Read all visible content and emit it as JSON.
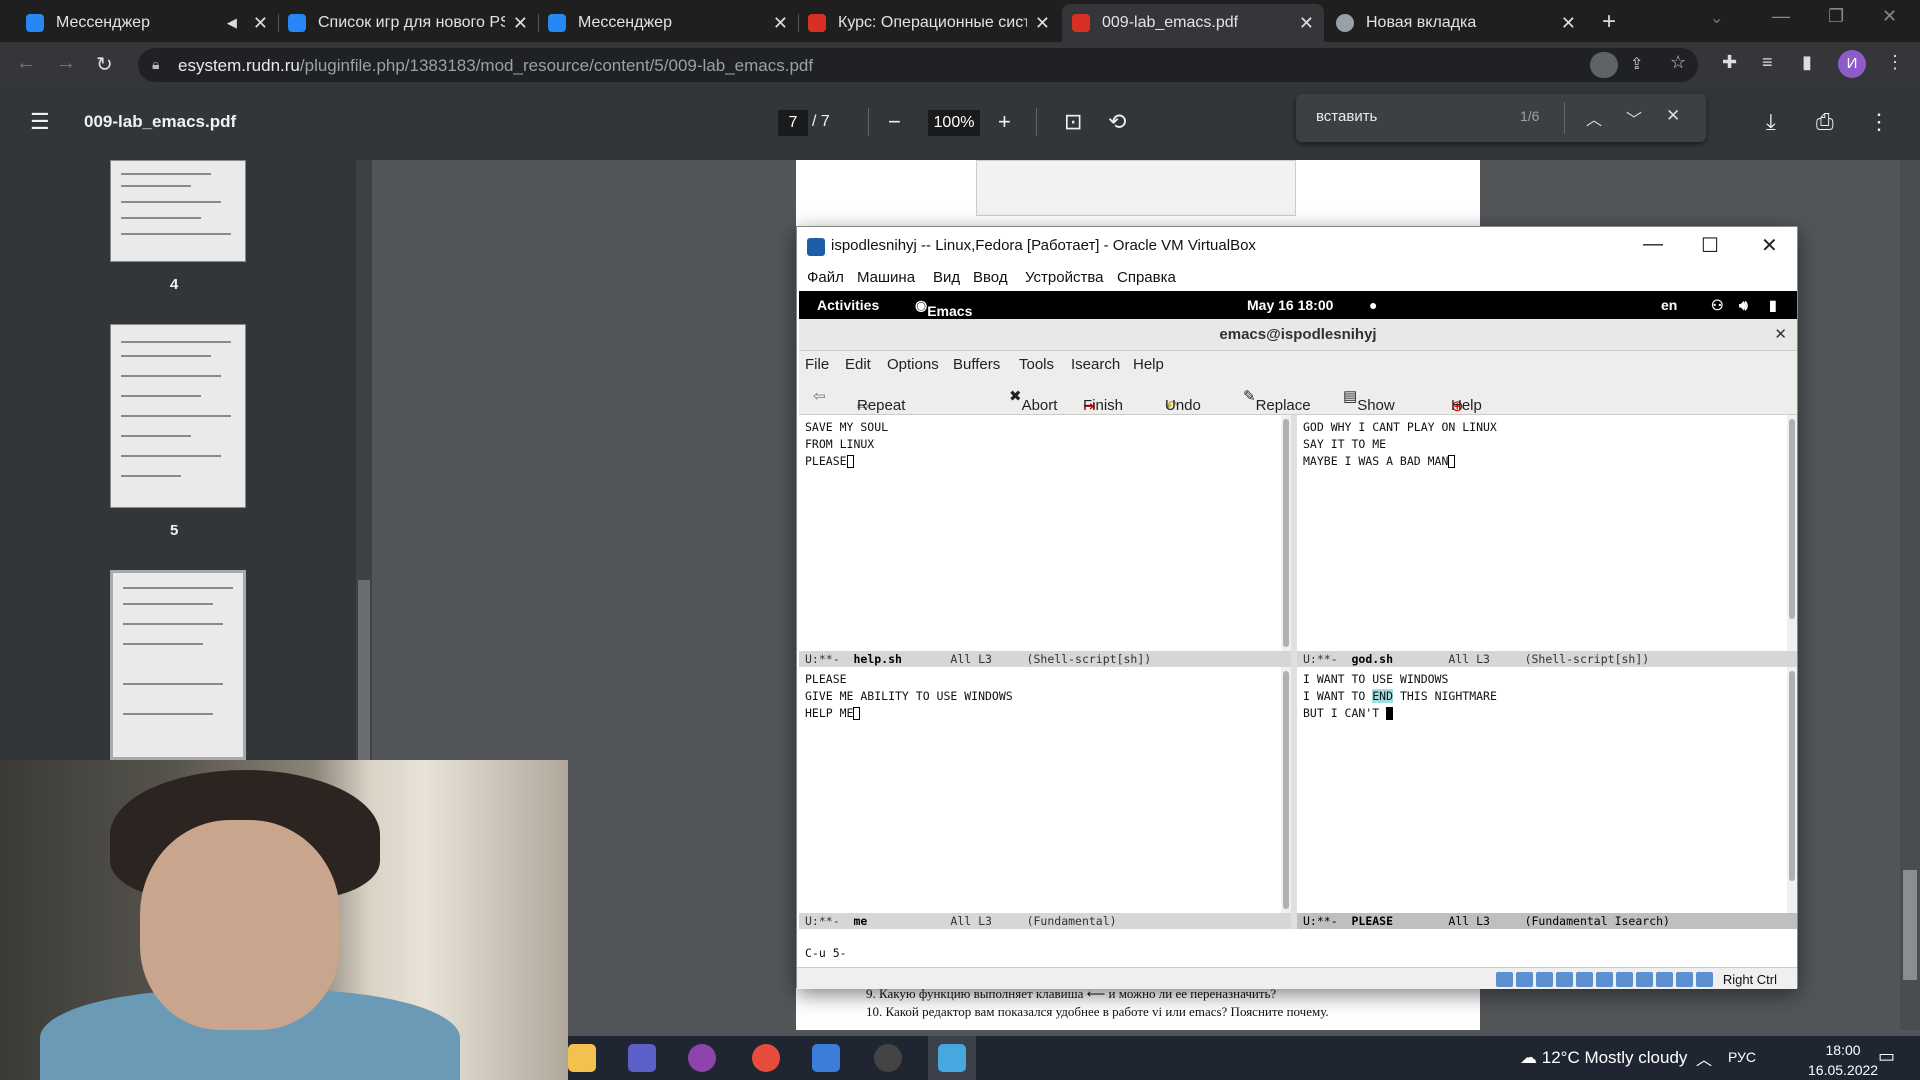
{
  "browser": {
    "tabs": [
      {
        "label": "Мессенджер",
        "color": "#2787f5"
      },
      {
        "label": "Список игр для нового PS",
        "color": "#2787f5"
      },
      {
        "label": "Мессенджер",
        "color": "#2787f5"
      },
      {
        "label": "Курс: Операционные сист",
        "color": "#d93025"
      },
      {
        "label": "009-lab_emacs.pdf",
        "color": "#d93025"
      },
      {
        "label": "Новая вкладка",
        "color": "#9aa0a6"
      }
    ],
    "url_host": "esystem.rudn.ru",
    "url_path": "/pluginfile.php/1383183/mod_resource/content/5/009-lab_emacs.pdf",
    "profile_initial": "И"
  },
  "pdf": {
    "title": "009-lab_emacs.pdf",
    "page_current": "7",
    "page_total": "/ 7",
    "zoom": "100%",
    "thumb_labels": [
      "4",
      "5"
    ],
    "lines": [
      "9.   Какую функцию выполняет клавиша ⟵ и можно ли ее переназначить?",
      "10.  Какой редактор вам показался удобнее в работе vi или emacs? Поясните почему."
    ]
  },
  "find": {
    "query": "вставить",
    "count": "1/6"
  },
  "vbox": {
    "title": "ispodlesnihyj -- Linux,Fedora [Работает] - Oracle VM VirtualBox",
    "menu": [
      "Файл",
      "Машина",
      "Вид",
      "Ввод",
      "Устройства",
      "Справка"
    ],
    "host_key": "Right Ctrl"
  },
  "gnome": {
    "activities": "Activities",
    "app": "Emacs",
    "clock": "May 16  18:00",
    "lang": "en"
  },
  "emacs": {
    "title": "emacs@ispodlesnihyj",
    "menu": [
      "File",
      "Edit",
      "Options",
      "Buffers",
      "Tools",
      "Isearch",
      "Help"
    ],
    "toolbar": [
      "Repeat Forward",
      "Abort",
      "Finish",
      "Undo",
      "Replace",
      "Show Hits",
      "Help"
    ],
    "panes": {
      "top_left": [
        "SAVE MY SOUL",
        "FROM LINUX",
        "PLEASE"
      ],
      "top_right": [
        "GOD WHY I CANT PLAY ON LINUX",
        "SAY IT TO ME",
        "MAYBE I WAS A BAD MAN"
      ],
      "bottom_left": [
        "PLEASE",
        "GIVE ME ABILITY TO USE WINDOWS",
        "HELP ME"
      ],
      "bottom_right_1": "I WANT TO USE WINDOWS",
      "bottom_right_2_pre": "I WANT TO ",
      "bottom_right_2_hl": "END",
      "bottom_right_2_post": " THIS NIGHTMARE",
      "bottom_right_3": "BUT I CAN'T "
    },
    "modelines": {
      "top_left": {
        "state": "U:**-  ",
        "name": "help.sh",
        "pos": "       All L3     (Shell-script[sh])"
      },
      "top_right": {
        "state": "U:**-  ",
        "name": "god.sh",
        "pos": "        All L3     (Shell-script[sh])"
      },
      "bottom_left": {
        "state": "U:**-  ",
        "name": "me",
        "pos": "            All L3     (Fundamental)"
      },
      "bottom_right": {
        "state": "U:**-  ",
        "name": "PLEASE",
        "pos": "        All L3     (Fundamental Isearch)"
      }
    },
    "minibuffer": "C-u 5-"
  },
  "taskbar": {
    "weather": "12°C  Mostly cloudy",
    "lang": "РУС",
    "time": "18:00",
    "date": "16.05.2022"
  }
}
